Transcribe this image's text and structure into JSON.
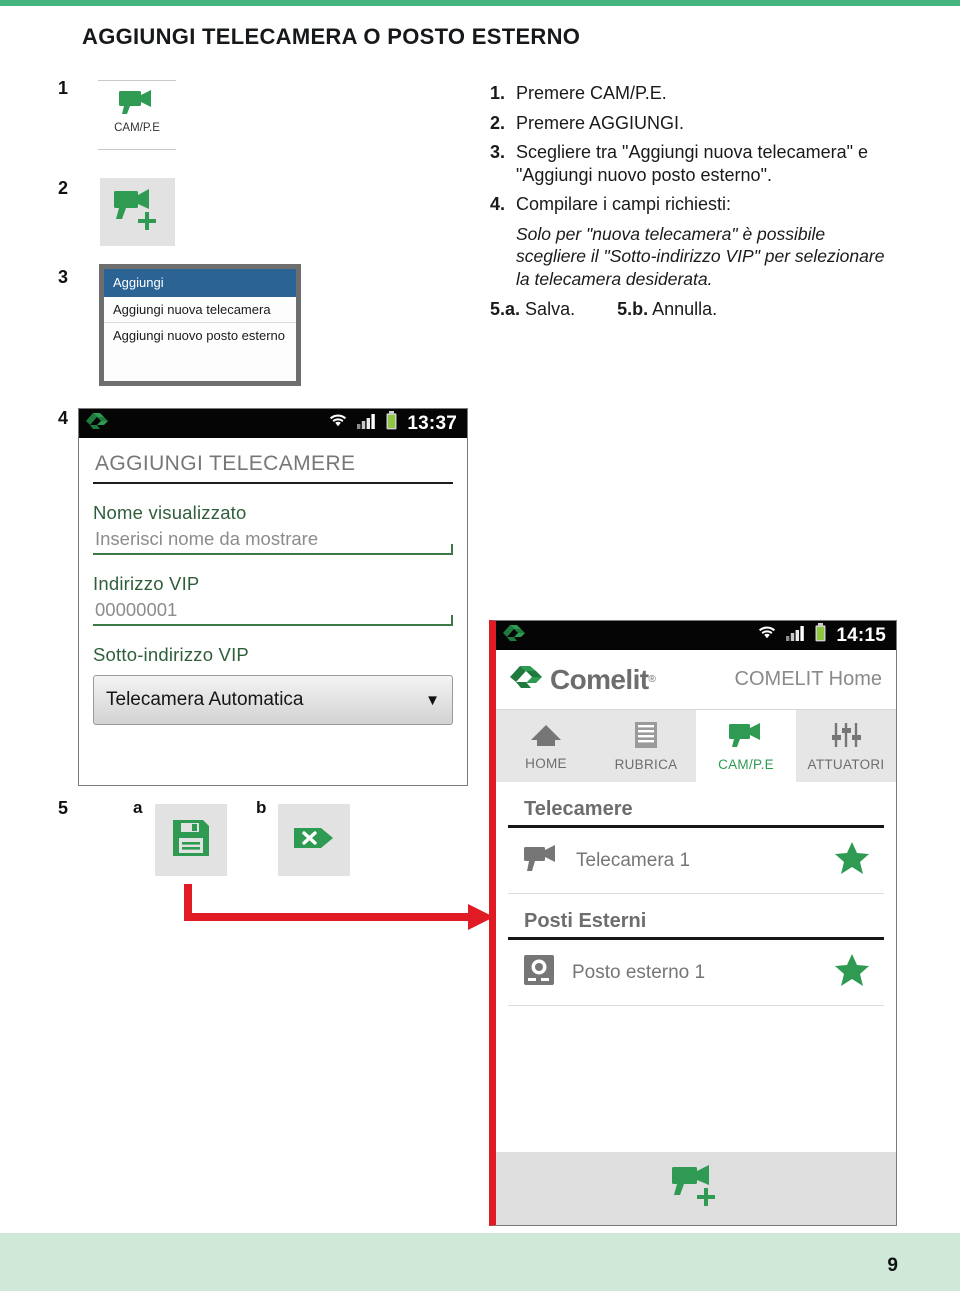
{
  "page": {
    "title": "AGGIUNGI TELECAMERA O POSTO ESTERNO",
    "number": "9",
    "accent_green": "#45b47f",
    "footer_green": "#cfe8d7",
    "brand_green": "#2f9a52",
    "arrow_red": "#e01b23"
  },
  "steps": {
    "n1": "1",
    "n2": "2",
    "n3": "3",
    "n4": "4",
    "n5": "5",
    "s5a": "a",
    "s5b": "b"
  },
  "instructions": [
    {
      "n": "1.",
      "text": "Premere CAM/P.E."
    },
    {
      "n": "2.",
      "text": "Premere AGGIUNGI."
    },
    {
      "n": "3.",
      "text": "Scegliere tra \"Aggiungi nuova telecamera\" e \"Aggiungi nuovo posto esterno\"."
    },
    {
      "n": "4.",
      "text": "Compilare i campi richiesti:"
    }
  ],
  "note": "Solo per \"nuova telecamera\" è possibile scegliere il \"Sotto-indirizzo VIP\" per selezionare la telecamera desiderata.",
  "final_steps": [
    {
      "n": "5.a.",
      "text": "Salva."
    },
    {
      "n": "5.b.",
      "text": "Annulla."
    }
  ],
  "tile1": {
    "label": "CAM/P.E",
    "icon": "camera-icon"
  },
  "tile2": {
    "icon": "add-camera-icon"
  },
  "popup": {
    "header": "Aggiungi",
    "items": [
      "Aggiungi nuova telecamera",
      "Aggiungi nuovo posto esterno"
    ],
    "header_color": "#2b6395"
  },
  "phone_left": {
    "statusbar": {
      "time": "13:37",
      "icons": [
        "comelit-mark-icon",
        "wifi-icon",
        "signal-icon",
        "battery-icon"
      ]
    },
    "screen_title": "AGGIUNGI TELECAMERE",
    "fields": [
      {
        "label": "Nome visualizzato",
        "value": "Inserisci nome da mostrare",
        "placeholder": "Inserisci nome da mostrare",
        "type": "text"
      },
      {
        "label": "Indirizzo VIP",
        "value": "00000001",
        "placeholder": "00000001",
        "type": "text"
      }
    ],
    "select": {
      "label": "Sotto-indirizzo VIP",
      "value": "Telecamera Automatica",
      "caret": "▼"
    }
  },
  "phone_right": {
    "statusbar": {
      "time": "14:15",
      "icons": [
        "comelit-mark-icon",
        "wifi-icon",
        "signal-icon",
        "battery-icon"
      ]
    },
    "brand": {
      "name": "Comelit",
      "reg": "®",
      "home_label": "COMELIT Home"
    },
    "nav": [
      {
        "label": "HOME",
        "icon": "home-icon",
        "active": false
      },
      {
        "label": "RUBRICA",
        "icon": "list-icon",
        "active": false
      },
      {
        "label": "CAM/P.E",
        "icon": "camera-icon",
        "active": true
      },
      {
        "label": "ATTUATORI",
        "icon": "sliders-icon",
        "active": false
      }
    ],
    "sections": [
      {
        "title": "Telecamere",
        "rows": [
          {
            "label": "Telecamera 1",
            "icon": "camera-icon",
            "star": "★"
          }
        ]
      },
      {
        "title": "Posti Esterni",
        "rows": [
          {
            "label": "Posto esterno 1",
            "icon": "entrance-panel-icon",
            "star": "★"
          }
        ]
      }
    ],
    "add_button": {
      "icon": "add-camera-icon"
    }
  },
  "buttons": {
    "save": {
      "icon": "floppy-save-icon"
    },
    "cancel": {
      "icon": "cancel-x-icon"
    }
  }
}
